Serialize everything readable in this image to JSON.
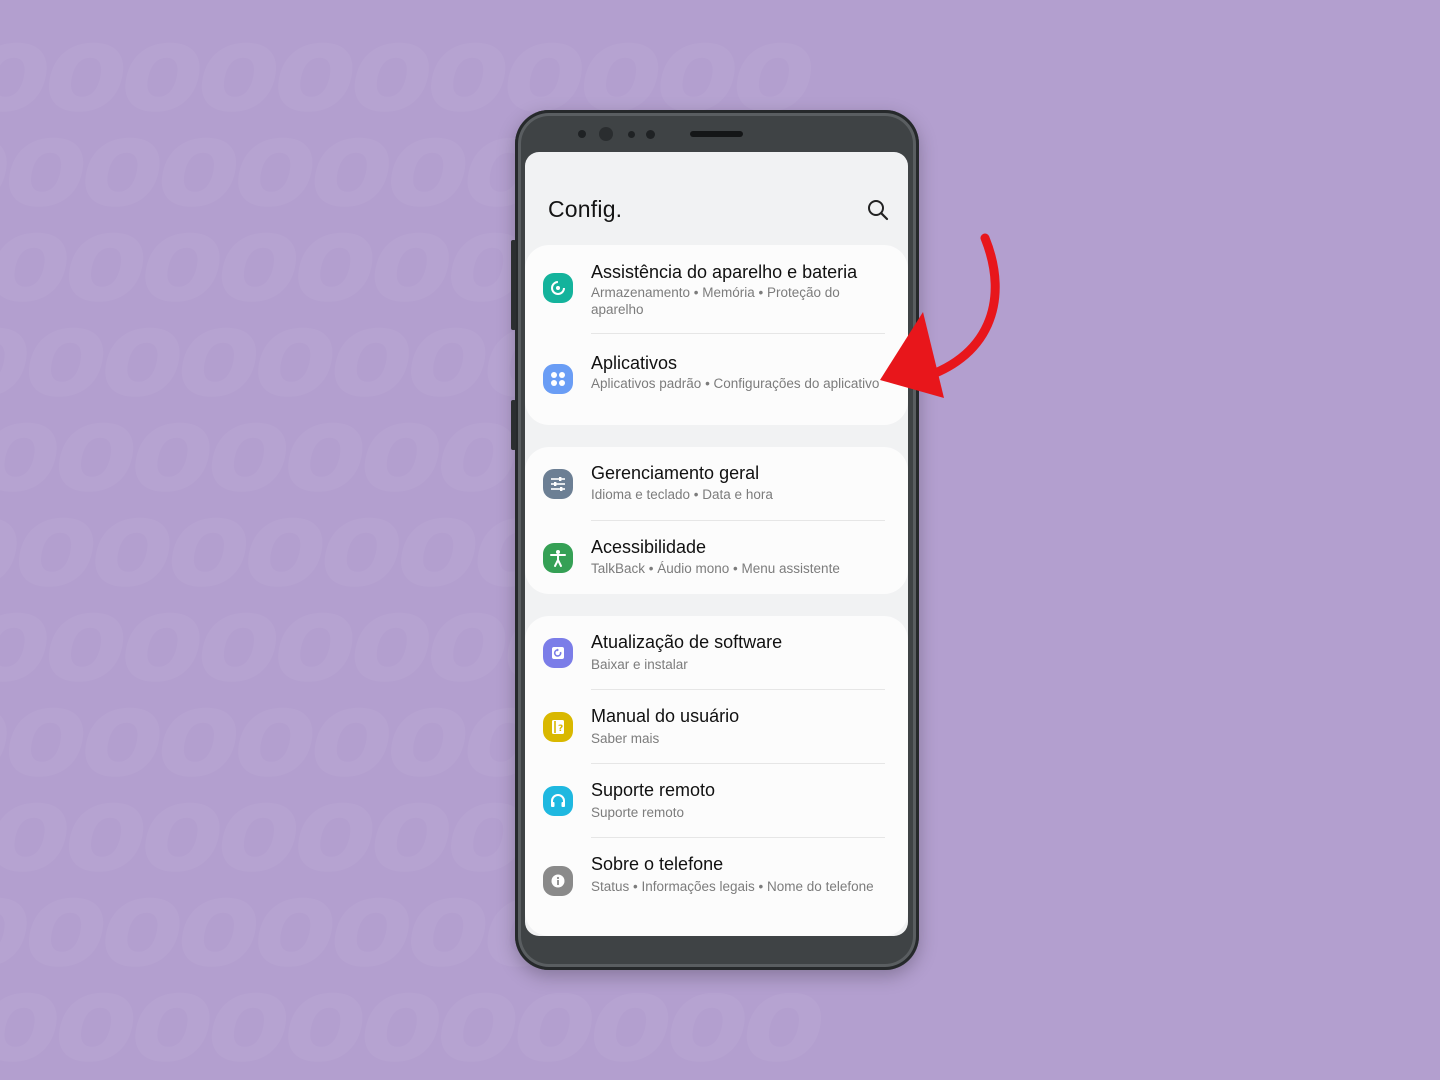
{
  "colors": {
    "background": "#b39fcf",
    "arrow": "#e8161b",
    "device_care": "#14b39c",
    "apps": "#6a9df5",
    "general_management": "#6c7f94",
    "accessibility": "#35a055",
    "software_update": "#7b7de8",
    "user_manual": "#d9b800",
    "remote_support": "#1fb8e0",
    "about_phone": "#8a8a8a"
  },
  "header": {
    "title": "Config.",
    "search_icon": "search-icon"
  },
  "groups": [
    {
      "items": [
        {
          "label": "Assistência do aparelho e bateria",
          "subtitle": "Armazenamento  •  Memória  •  Proteção do aparelho",
          "icon": "device-care-icon"
        },
        {
          "label": "Aplicativos",
          "subtitle": "Aplicativos padrão  •  Configurações do aplicativo",
          "icon": "apps-icon"
        }
      ]
    },
    {
      "items": [
        {
          "label": "Gerenciamento geral",
          "subtitle": "Idioma e teclado  •  Data e hora",
          "icon": "sliders-icon"
        },
        {
          "label": "Acessibilidade",
          "subtitle": "TalkBack  •  Áudio mono  •  Menu assistente",
          "icon": "accessibility-icon"
        }
      ]
    },
    {
      "items": [
        {
          "label": "Atualização de software",
          "subtitle": "Baixar e instalar",
          "icon": "software-update-icon"
        },
        {
          "label": "Manual do usuário",
          "subtitle": "Saber mais",
          "icon": "user-manual-icon"
        },
        {
          "label": "Suporte remoto",
          "subtitle": "Suporte remoto",
          "icon": "headset-icon"
        },
        {
          "label": "Sobre o telefone",
          "subtitle": "Status  •  Informações legais  •  Nome do telefone",
          "icon": "info-icon"
        }
      ]
    }
  ]
}
